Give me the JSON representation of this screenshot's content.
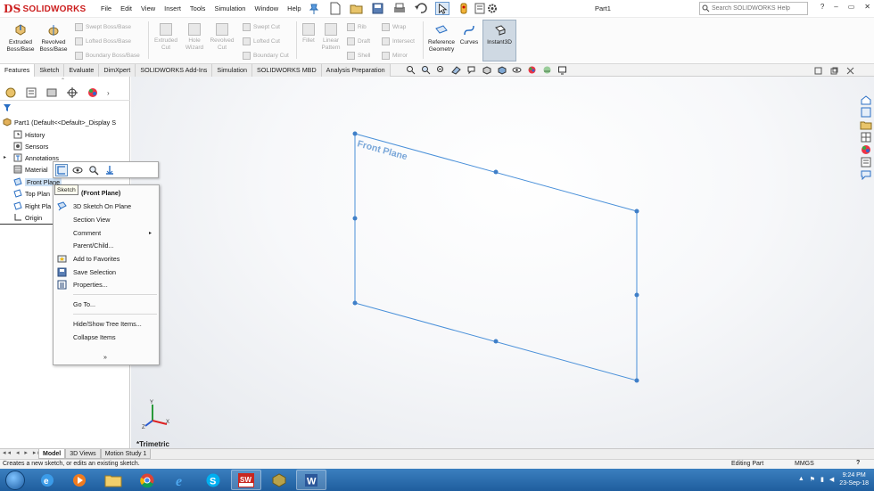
{
  "app": {
    "brand": "SOLIDWORKS",
    "brand_mark": "DS",
    "doc_title": "Part1",
    "menu": [
      "File",
      "Edit",
      "View",
      "Insert",
      "Tools",
      "Simulation",
      "Window",
      "Help"
    ],
    "search_placeholder": "Search SOLIDWORKS Help",
    "window_controls": [
      "?",
      "–",
      "▭",
      "✕"
    ]
  },
  "commands": {
    "big": [
      {
        "label1": "Extruded",
        "label2": "Boss/Base",
        "enabled": true
      },
      {
        "label1": "Revolved",
        "label2": "Boss/Base",
        "enabled": true
      },
      {
        "label1": "Extruded",
        "label2": "Cut",
        "enabled": false
      },
      {
        "label1": "Hole",
        "label2": "Wizard",
        "enabled": false
      },
      {
        "label1": "Revolved",
        "label2": "Cut",
        "enabled": false
      },
      {
        "label1": "Fillet",
        "label2": "",
        "enabled": false
      },
      {
        "label1": "Linear",
        "label2": "Pattern",
        "enabled": false
      },
      {
        "label1": "Reference",
        "label2": "Geometry",
        "enabled": true
      },
      {
        "label1": "Curves",
        "label2": "",
        "enabled": true
      }
    ],
    "small_col1": [
      "Swept Boss/Base",
      "Lofted Boss/Base",
      "Boundary Boss/Base"
    ],
    "small_col2": [
      "Swept Cut",
      "Lofted Cut",
      "Boundary Cut"
    ],
    "small_col3": [
      "Rib",
      "Draft",
      "Shell"
    ],
    "small_col4": [
      "Wrap",
      "Intersect",
      "Mirror"
    ],
    "instant3d": "Instant3D"
  },
  "tabs": [
    "Features",
    "Sketch",
    "Evaluate",
    "DimXpert",
    "SOLIDWORKS Add-Ins",
    "Simulation",
    "SOLIDWORKS MBD",
    "Analysis Preparation"
  ],
  "active_tab": "Features",
  "tree": {
    "root": "Part1  (Default<<Default>_Display S",
    "items": [
      {
        "label": "History"
      },
      {
        "label": "Sensors"
      },
      {
        "label": "Annotations"
      },
      {
        "label": "Material"
      },
      {
        "label": "Front Plane"
      },
      {
        "label": "Top Plan"
      },
      {
        "label": "Right Pla"
      },
      {
        "label": "Origin"
      }
    ]
  },
  "graphics": {
    "plane_label": "Front Plane",
    "view_name": "*Trimetric",
    "axes": {
      "x": "X",
      "y": "Y",
      "z": "Z"
    },
    "accent": "#4a90d9"
  },
  "context": {
    "tooltip": "Sketch",
    "header": "(Front Plane)",
    "items": [
      {
        "label": "3D Sketch On Plane",
        "icon": "3d-sketch-icon",
        "submenu": false
      },
      {
        "label": "Section View",
        "icon": "",
        "submenu": false
      },
      {
        "label": "Comment",
        "icon": "",
        "submenu": true
      },
      {
        "label": "Parent/Child...",
        "icon": "",
        "submenu": false
      },
      {
        "label": "Add to Favorites",
        "icon": "favorites-icon",
        "submenu": false
      },
      {
        "label": "Save Selection",
        "icon": "save-selection-icon",
        "submenu": false
      },
      {
        "label": "Properties...",
        "icon": "properties-icon",
        "submenu": false
      },
      {
        "label": "Go To...",
        "icon": "",
        "submenu": false
      },
      {
        "label": "Hide/Show Tree Items...",
        "icon": "",
        "submenu": false
      },
      {
        "label": "Collapse Items",
        "icon": "",
        "submenu": false
      }
    ],
    "more": "»"
  },
  "bottom_tabs": [
    "Model",
    "3D Views",
    "Motion Study 1"
  ],
  "active_bottom_tab": "Model",
  "status": {
    "text": "Creates a new sketch, or edits an existing sketch.",
    "mode": "Editing Part",
    "units": "MMGS",
    "help": "?"
  },
  "taskbar": {
    "apps": [
      "ie-icon",
      "media-player-icon",
      "explorer-icon",
      "chrome-icon",
      "internet-explorer-icon",
      "skype-icon",
      "solidworks-icon",
      "3d-app-icon",
      "word-icon"
    ],
    "time": "9:24 PM",
    "date": "23-Sep-18"
  }
}
